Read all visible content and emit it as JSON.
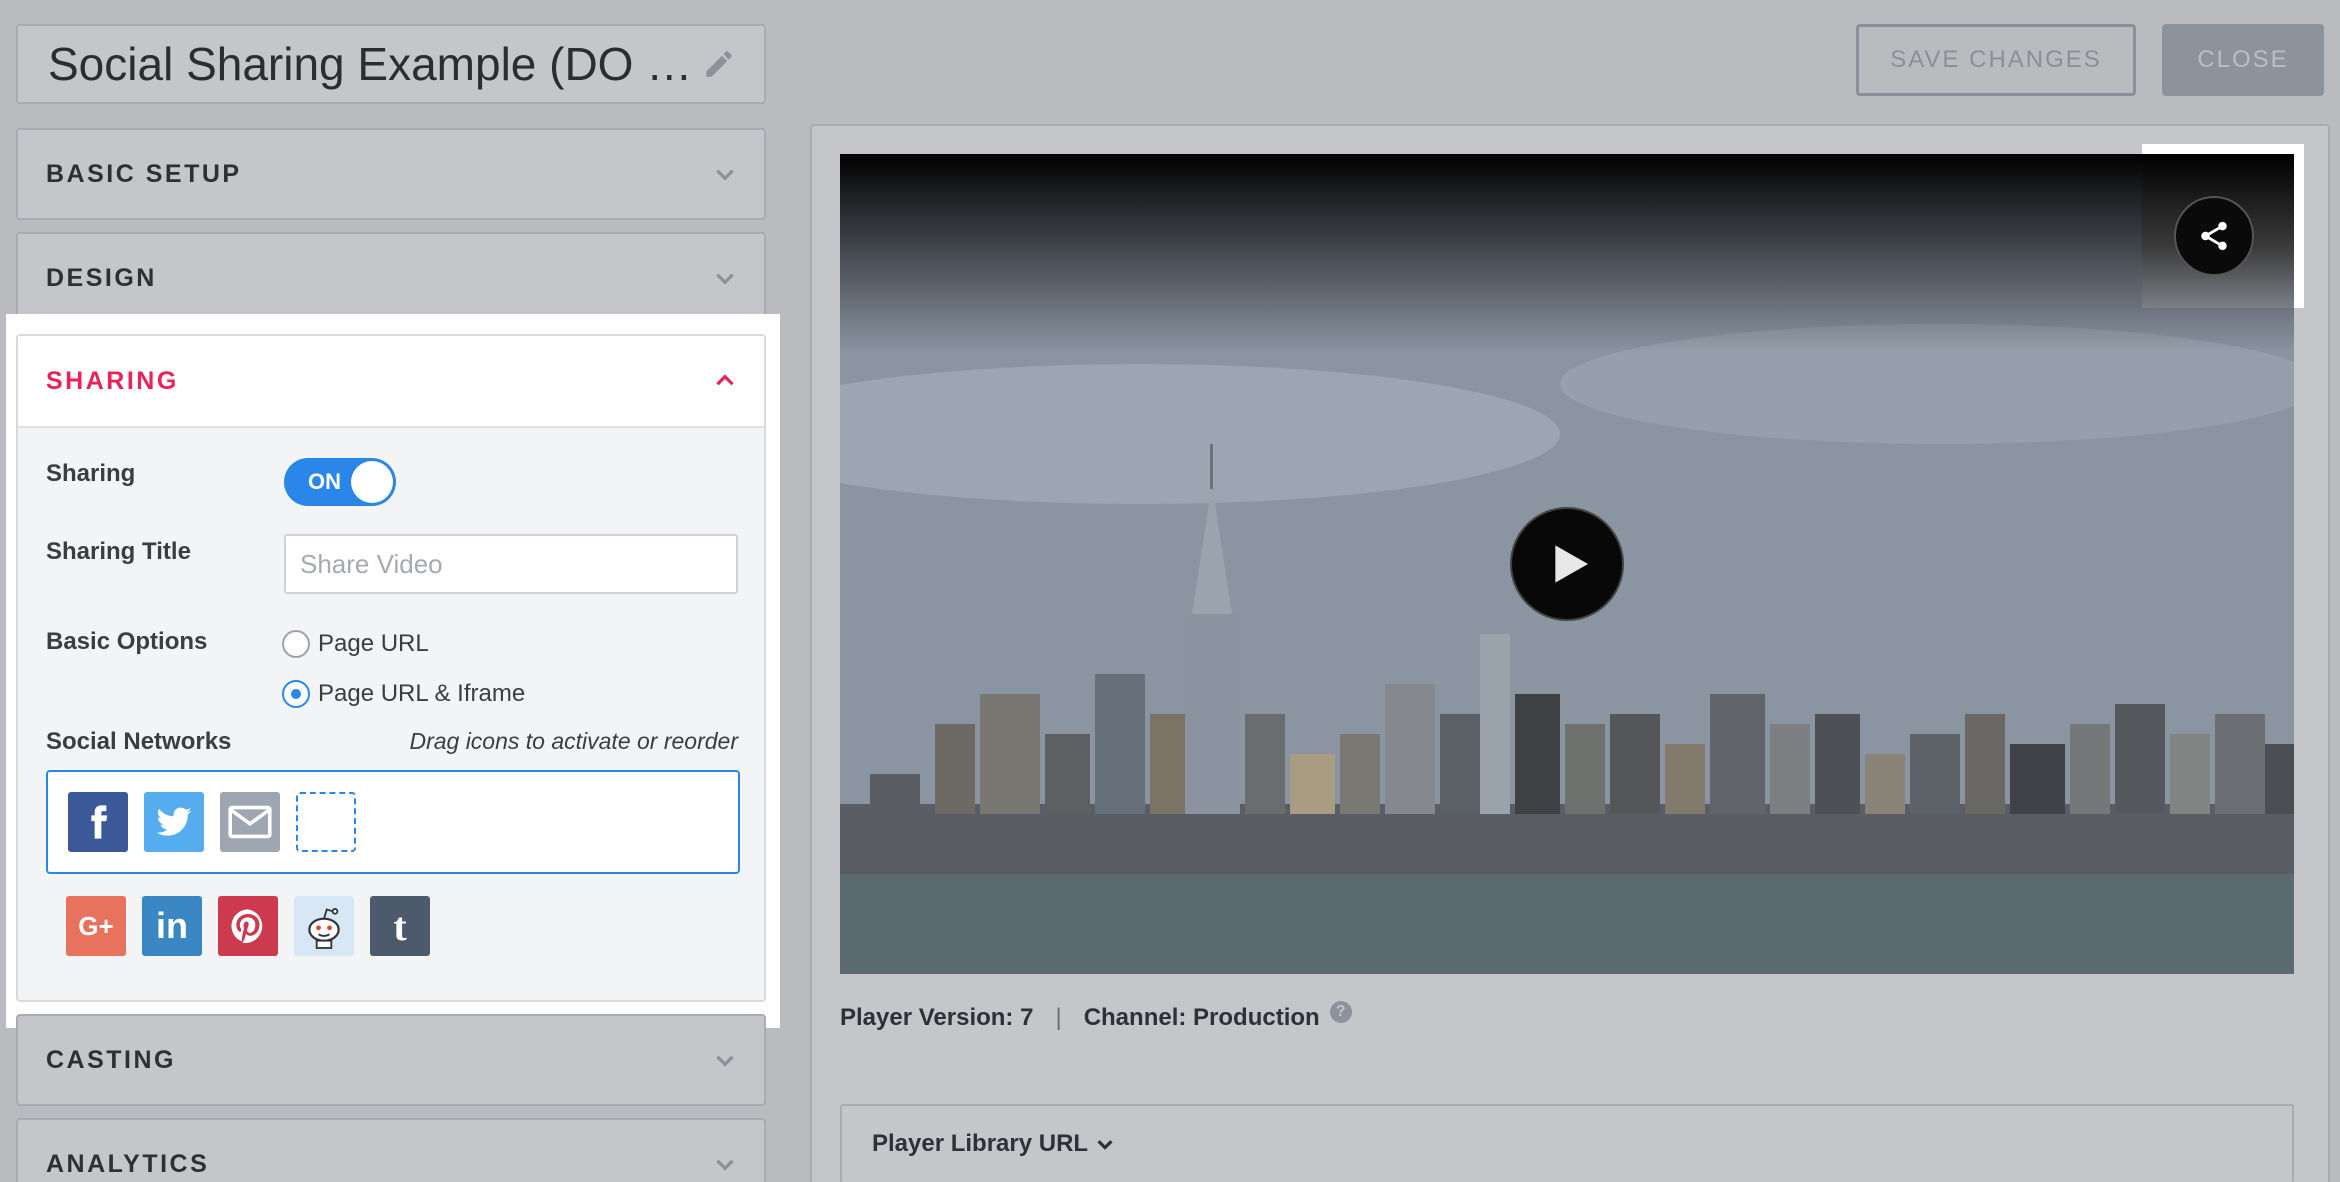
{
  "header": {
    "title": "Social Sharing Example (DO …",
    "save_label": "SAVE CHANGES",
    "close_label": "CLOSE"
  },
  "sections": {
    "basic_setup": "BASIC SETUP",
    "design": "DESIGN",
    "sharing": "SHARING",
    "casting": "CASTING",
    "analytics": "ANALYTICS"
  },
  "sharing": {
    "toggle_label": "Sharing",
    "toggle_state": "ON",
    "title_label": "Sharing Title",
    "title_placeholder": "Share Video",
    "title_value": "",
    "options_label": "Basic Options",
    "options": [
      "Page URL",
      "Page URL & Iframe"
    ],
    "selected_option": "Page URL & Iframe",
    "networks_label": "Social Networks",
    "networks_hint": "Drag icons to activate or reorder",
    "active_networks": [
      "facebook",
      "twitter",
      "email"
    ],
    "available_networks": [
      "google-plus",
      "linkedin",
      "pinterest",
      "reddit",
      "tumblr"
    ],
    "colors": {
      "facebook": "#3b5998",
      "twitter": "#55acee",
      "email": "#9ea6b2",
      "google-plus": "#e7735f",
      "linkedin": "#3a87c4",
      "pinterest": "#cb3a4f",
      "reddit": "#d7e7f6",
      "tumblr": "#4d5a6c",
      "accent": "#2a86e8",
      "active_section": "#e8245a"
    }
  },
  "preview": {
    "player_version": "Player Version: 7",
    "separator": "|",
    "channel": "Channel: Production",
    "help_symbol": "?",
    "library_label": "Player Library URL"
  }
}
